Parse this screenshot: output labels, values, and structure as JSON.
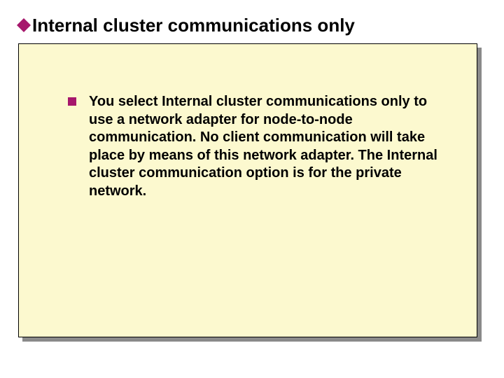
{
  "title": "Internal cluster communications only",
  "body": "You select Internal cluster communications only to use a network adapter for node-to-node communication. No client communication will take place by means of this network adapter. The Internal cluster communication option is for the private network.",
  "colors": {
    "accent": "#a6176c",
    "panel": "#fcf9cf",
    "shadow": "#8a8a8a"
  }
}
